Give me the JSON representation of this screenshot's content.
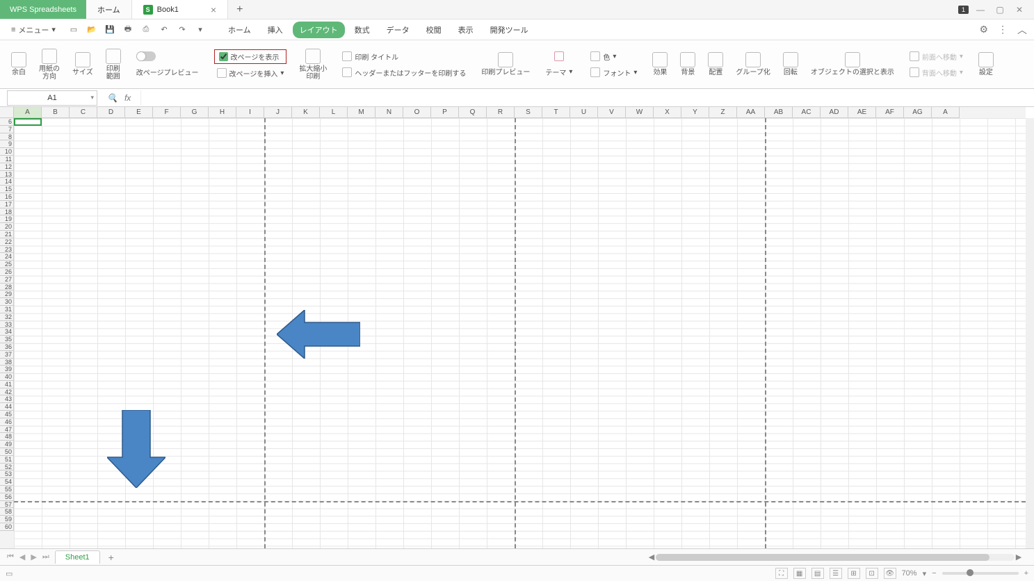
{
  "app": {
    "name": "WPS Spreadsheets"
  },
  "tabs": {
    "home_tab": "ホーム",
    "doc1": {
      "name": "Book1",
      "badge": "S"
    },
    "notif_count": "1"
  },
  "menu": {
    "button": "メニュー",
    "items": [
      "ホーム",
      "挿入",
      "レイアウト",
      "数式",
      "データ",
      "校閲",
      "表示",
      "開発ツール"
    ],
    "active_index": 2
  },
  "ribbon": {
    "margins": "余白",
    "orientation": "用紙の\n方向",
    "size": "サイズ",
    "print_area": "印刷\n範囲",
    "page_break_preview": "改ページプレビュー",
    "show_page_break": "改ページを表示",
    "insert_page_break": "改ページを挿入",
    "zoom_print": "拡大縮小\n印刷",
    "print_title": "印刷 タイトル",
    "header_footer": "ヘッダーまたはフッターを印刷する",
    "print_preview": "印刷プレビュー",
    "theme": "テーマ",
    "color": "色",
    "font": "フォント",
    "effects": "効果",
    "background": "背景",
    "align": "配置",
    "group": "グループ化",
    "rotate": "回転",
    "select_objects": "オブジェクトの選択と表示",
    "bring_front": "前面へ移動",
    "send_back": "背面へ移動",
    "settings": "設定"
  },
  "namebox": "A1",
  "columns": [
    "A",
    "B",
    "C",
    "D",
    "E",
    "F",
    "G",
    "H",
    "I",
    "J",
    "K",
    "L",
    "M",
    "N",
    "O",
    "P",
    "Q",
    "R",
    "S",
    "T",
    "U",
    "V",
    "W",
    "X",
    "Y",
    "Z",
    "AA",
    "AB",
    "AC",
    "AD",
    "AE",
    "AF",
    "AG",
    "A"
  ],
  "row_start": 6,
  "row_end": 60,
  "sheet": {
    "name": "Sheet1"
  },
  "status": {
    "zoom": "70%"
  }
}
